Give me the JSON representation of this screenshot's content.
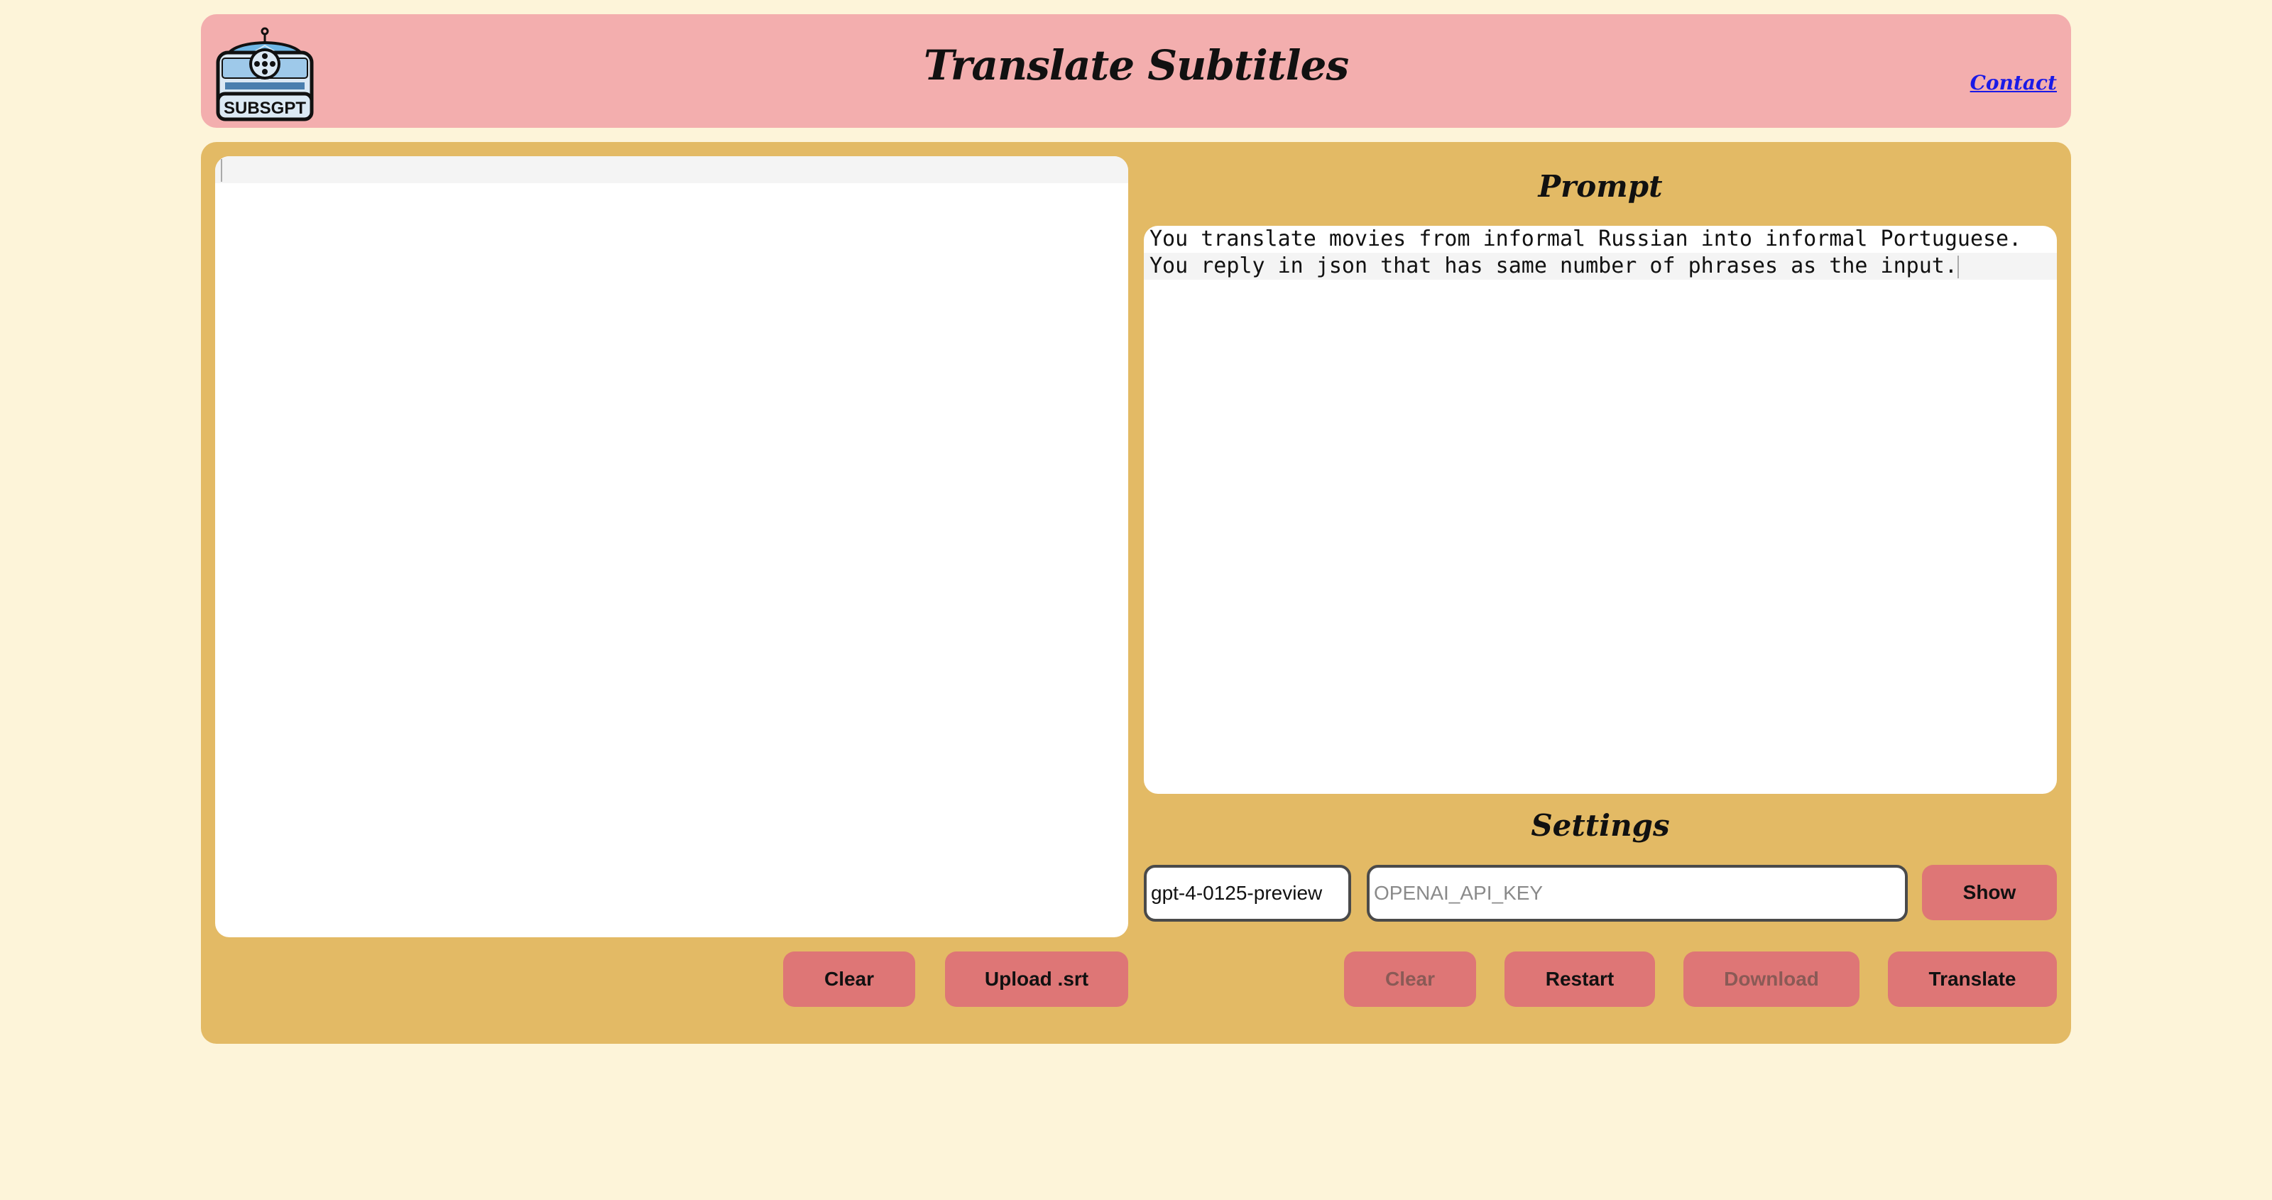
{
  "header": {
    "logo_text": "SUBSGPT",
    "title": "Translate Subtitles",
    "contact_label": "Contact"
  },
  "left_panel": {
    "content": "",
    "clear_label": "Clear",
    "upload_label": "Upload .srt"
  },
  "prompt": {
    "heading": "Prompt",
    "lines": [
      "You translate movies from informal Russian into informal Portuguese.",
      "You reply in json that has same number of phrases as the input."
    ]
  },
  "settings": {
    "heading": "Settings",
    "model_value": "gpt-4-0125-preview",
    "api_key_value": "",
    "api_key_placeholder": "OPENAI_API_KEY",
    "show_label": "Show"
  },
  "actions": {
    "clear_label": "Clear",
    "restart_label": "Restart",
    "download_label": "Download",
    "translate_label": "Translate"
  },
  "colors": {
    "page_bg": "#fdf4d9",
    "header_bg": "#f3aeae",
    "panel_bg": "#e3ba65",
    "button_bg": "#de7676",
    "link": "#1a1ae6"
  }
}
